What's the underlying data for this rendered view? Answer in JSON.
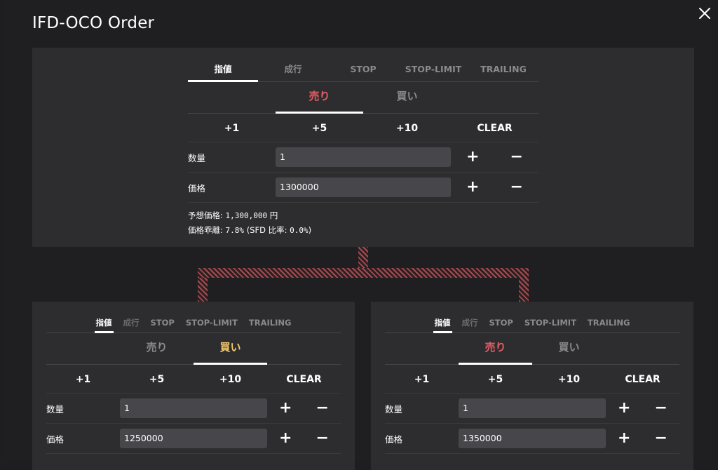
{
  "dialog": {
    "title": "IFD-OCO Order",
    "close_icon": "close-icon"
  },
  "top": {
    "tabs": [
      "指値",
      "成行",
      "STOP",
      "STOP-LIMIT",
      "TRAILING"
    ],
    "active_tab": 0,
    "side": {
      "sell": "売り",
      "buy": "買い",
      "active": "sell"
    },
    "increments": [
      "+1",
      "+5",
      "+10",
      "CLEAR"
    ],
    "qty_label": "数量",
    "qty_value": "1",
    "price_label": "価格",
    "price_value": "1300000",
    "plus": "+",
    "minus": "−",
    "expected_label": "予想価格:",
    "expected_value": "1,300,000",
    "expected_unit": "円",
    "deviation_label": "価格乖離:",
    "deviation_value": "7.8%",
    "sfd_label": "(SFD 比率:",
    "sfd_value": "0.0%",
    "sfd_close": ")"
  },
  "left": {
    "tabs": [
      "指値",
      "成行",
      "STOP",
      "STOP-LIMIT",
      "TRAILING"
    ],
    "active_tab": 0,
    "side": {
      "sell": "売り",
      "buy": "買い",
      "active": "buy"
    },
    "increments": [
      "+1",
      "+5",
      "+10",
      "CLEAR"
    ],
    "qty_label": "数量",
    "qty_value": "1",
    "price_label": "価格",
    "price_value": "1250000",
    "plus": "+",
    "minus": "−"
  },
  "right": {
    "tabs": [
      "指値",
      "成行",
      "STOP",
      "STOP-LIMIT",
      "TRAILING"
    ],
    "active_tab": 0,
    "side": {
      "sell": "売り",
      "buy": "買い",
      "active": "sell"
    },
    "increments": [
      "+1",
      "+5",
      "+10",
      "CLEAR"
    ],
    "qty_label": "数量",
    "qty_value": "1",
    "price_label": "価格",
    "price_value": "1350000",
    "plus": "+",
    "minus": "−"
  },
  "colors": {
    "sell_active": "#e45d63",
    "buy_active": "#f4c96b",
    "panel": "#2d2d30",
    "connector": "#a94a50"
  }
}
